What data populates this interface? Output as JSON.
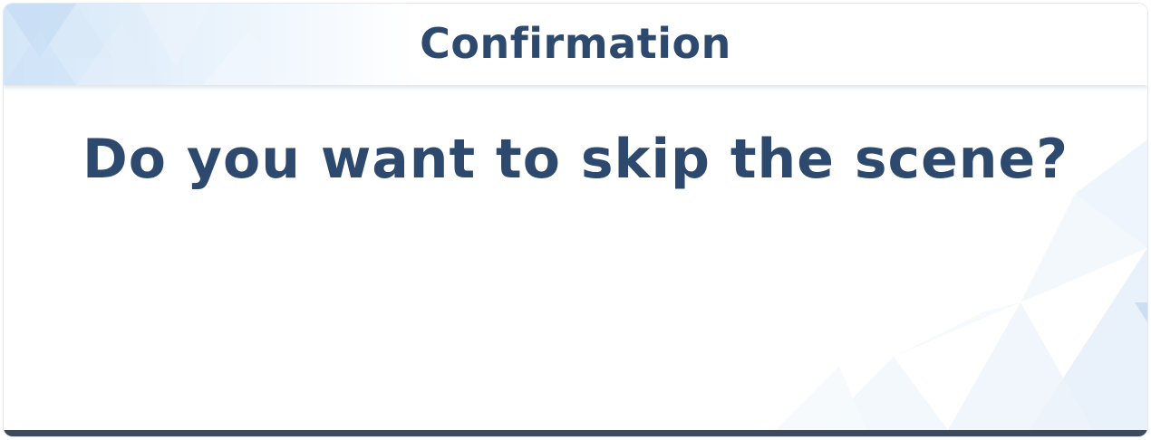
{
  "dialog": {
    "title": "Confirmation",
    "message": "Do you want to skip the scene?"
  },
  "colors": {
    "text": "#2d4a6e",
    "bottom_border": "#3c4a5f",
    "accent_light": "#d3e6f8"
  },
  "icons": {
    "header_decoration": "triangle-pattern-icon",
    "body_decoration": "triangle-pattern-icon"
  }
}
